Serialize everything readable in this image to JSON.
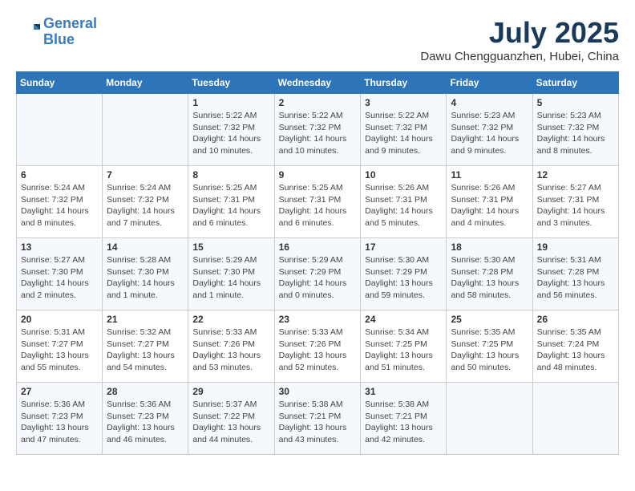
{
  "header": {
    "logo_line1": "General",
    "logo_line2": "Blue",
    "month_title": "July 2025",
    "location": "Dawu Chengguanzhen, Hubei, China"
  },
  "weekdays": [
    "Sunday",
    "Monday",
    "Tuesday",
    "Wednesday",
    "Thursday",
    "Friday",
    "Saturday"
  ],
  "weeks": [
    [
      {
        "day": "",
        "info": ""
      },
      {
        "day": "",
        "info": ""
      },
      {
        "day": "1",
        "sunrise": "5:22 AM",
        "sunset": "7:32 PM",
        "daylight": "14 hours and 10 minutes."
      },
      {
        "day": "2",
        "sunrise": "5:22 AM",
        "sunset": "7:32 PM",
        "daylight": "14 hours and 10 minutes."
      },
      {
        "day": "3",
        "sunrise": "5:22 AM",
        "sunset": "7:32 PM",
        "daylight": "14 hours and 9 minutes."
      },
      {
        "day": "4",
        "sunrise": "5:23 AM",
        "sunset": "7:32 PM",
        "daylight": "14 hours and 9 minutes."
      },
      {
        "day": "5",
        "sunrise": "5:23 AM",
        "sunset": "7:32 PM",
        "daylight": "14 hours and 8 minutes."
      }
    ],
    [
      {
        "day": "6",
        "sunrise": "5:24 AM",
        "sunset": "7:32 PM",
        "daylight": "14 hours and 8 minutes."
      },
      {
        "day": "7",
        "sunrise": "5:24 AM",
        "sunset": "7:32 PM",
        "daylight": "14 hours and 7 minutes."
      },
      {
        "day": "8",
        "sunrise": "5:25 AM",
        "sunset": "7:31 PM",
        "daylight": "14 hours and 6 minutes."
      },
      {
        "day": "9",
        "sunrise": "5:25 AM",
        "sunset": "7:31 PM",
        "daylight": "14 hours and 6 minutes."
      },
      {
        "day": "10",
        "sunrise": "5:26 AM",
        "sunset": "7:31 PM",
        "daylight": "14 hours and 5 minutes."
      },
      {
        "day": "11",
        "sunrise": "5:26 AM",
        "sunset": "7:31 PM",
        "daylight": "14 hours and 4 minutes."
      },
      {
        "day": "12",
        "sunrise": "5:27 AM",
        "sunset": "7:31 PM",
        "daylight": "14 hours and 3 minutes."
      }
    ],
    [
      {
        "day": "13",
        "sunrise": "5:27 AM",
        "sunset": "7:30 PM",
        "daylight": "14 hours and 2 minutes."
      },
      {
        "day": "14",
        "sunrise": "5:28 AM",
        "sunset": "7:30 PM",
        "daylight": "14 hours and 1 minute."
      },
      {
        "day": "15",
        "sunrise": "5:29 AM",
        "sunset": "7:30 PM",
        "daylight": "14 hours and 1 minute."
      },
      {
        "day": "16",
        "sunrise": "5:29 AM",
        "sunset": "7:29 PM",
        "daylight": "14 hours and 0 minutes."
      },
      {
        "day": "17",
        "sunrise": "5:30 AM",
        "sunset": "7:29 PM",
        "daylight": "13 hours and 59 minutes."
      },
      {
        "day": "18",
        "sunrise": "5:30 AM",
        "sunset": "7:28 PM",
        "daylight": "13 hours and 58 minutes."
      },
      {
        "day": "19",
        "sunrise": "5:31 AM",
        "sunset": "7:28 PM",
        "daylight": "13 hours and 56 minutes."
      }
    ],
    [
      {
        "day": "20",
        "sunrise": "5:31 AM",
        "sunset": "7:27 PM",
        "daylight": "13 hours and 55 minutes."
      },
      {
        "day": "21",
        "sunrise": "5:32 AM",
        "sunset": "7:27 PM",
        "daylight": "13 hours and 54 minutes."
      },
      {
        "day": "22",
        "sunrise": "5:33 AM",
        "sunset": "7:26 PM",
        "daylight": "13 hours and 53 minutes."
      },
      {
        "day": "23",
        "sunrise": "5:33 AM",
        "sunset": "7:26 PM",
        "daylight": "13 hours and 52 minutes."
      },
      {
        "day": "24",
        "sunrise": "5:34 AM",
        "sunset": "7:25 PM",
        "daylight": "13 hours and 51 minutes."
      },
      {
        "day": "25",
        "sunrise": "5:35 AM",
        "sunset": "7:25 PM",
        "daylight": "13 hours and 50 minutes."
      },
      {
        "day": "26",
        "sunrise": "5:35 AM",
        "sunset": "7:24 PM",
        "daylight": "13 hours and 48 minutes."
      }
    ],
    [
      {
        "day": "27",
        "sunrise": "5:36 AM",
        "sunset": "7:23 PM",
        "daylight": "13 hours and 47 minutes."
      },
      {
        "day": "28",
        "sunrise": "5:36 AM",
        "sunset": "7:23 PM",
        "daylight": "13 hours and 46 minutes."
      },
      {
        "day": "29",
        "sunrise": "5:37 AM",
        "sunset": "7:22 PM",
        "daylight": "13 hours and 44 minutes."
      },
      {
        "day": "30",
        "sunrise": "5:38 AM",
        "sunset": "7:21 PM",
        "daylight": "13 hours and 43 minutes."
      },
      {
        "day": "31",
        "sunrise": "5:38 AM",
        "sunset": "7:21 PM",
        "daylight": "13 hours and 42 minutes."
      },
      {
        "day": "",
        "info": ""
      },
      {
        "day": "",
        "info": ""
      }
    ]
  ]
}
